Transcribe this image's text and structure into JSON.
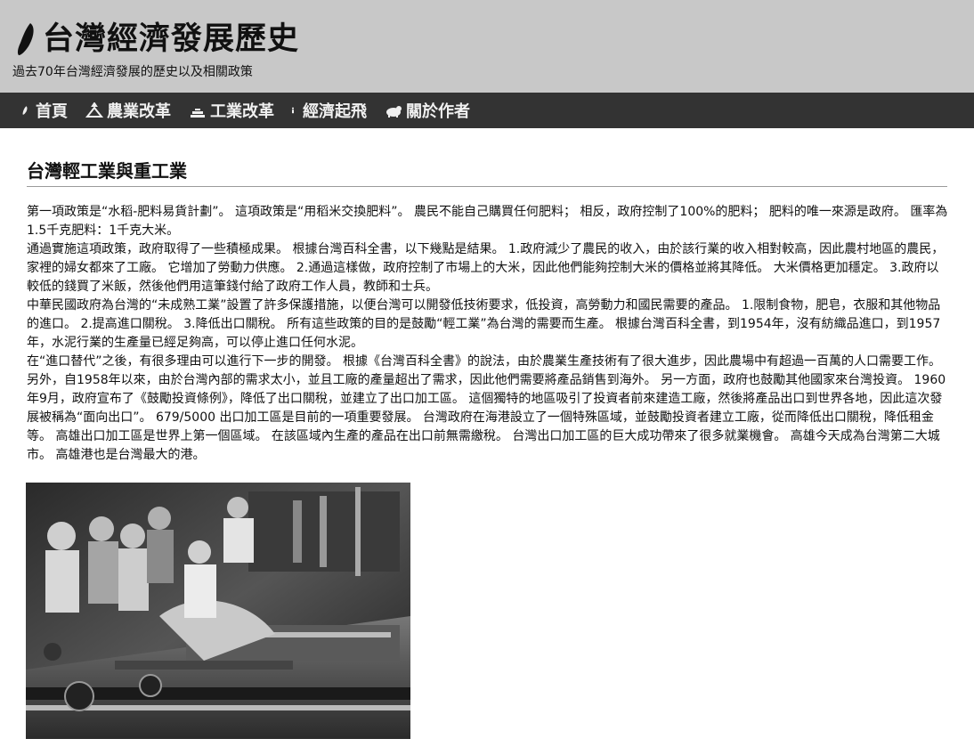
{
  "header": {
    "title": "台灣經濟發展歷史",
    "subtitle": "過去70年台灣經濟發展的歷史以及相關政策",
    "logo_icon": "taiwan-leaf-icon"
  },
  "nav": {
    "items": [
      {
        "label": "首頁",
        "icon": "leaf-icon"
      },
      {
        "label": "農業改革",
        "icon": "farmer-icon"
      },
      {
        "label": "工業改革",
        "icon": "factory-icon"
      },
      {
        "label": "經濟起飛",
        "icon": "info-icon"
      },
      {
        "label": "關於作者",
        "icon": "bear-icon"
      }
    ]
  },
  "article": {
    "heading": "台灣輕工業與重工業",
    "paragraphs": [
      "第一項政策是“水稻-肥料易貨計劃”。 這項政策是“用稻米交換肥料”。 農民不能自己購買任何肥料； 相反，政府控制了100%的肥料； 肥料的唯一來源是政府。 匯率為1.5千克肥料：1千克大米。",
      "通過實施這項政策，政府取得了一些積極成果。 根據台灣百科全書，以下幾點是結果。 1.政府減少了農民的收入，由於該行業的收入相對較高，因此農村地區的農民，家裡的婦女都來了工廠。 它增加了勞動力供應。 2.通過這樣做，政府控制了市場上的大米，因此他們能夠控制大米的價格並將其降低。 大米價格更加穩定。 3.政府以較低的錢買了米飯，然後他們用這筆錢付給了政府工作人員，教師和士兵。",
      "中華民國政府為台灣的“未成熟工業”設置了許多保護措施，以便台灣可以開發低技術要求，低投資，高勞動力和國民需要的產品。 1.限制食物，肥皂，衣服和其他物品的進口。 2.提高進口關稅。 3.降低出口關稅。 所有這些政策的目的是鼓勵“輕工業”為台灣的需要而生產。 根據台灣百科全書，到1954年，沒有紡織品進口，到1957年，水泥行業的生產量已經足夠高，可以停止進口任何水泥。",
      "在“進口替代”之後，有很多理由可以進行下一步的開發。 根據《台灣百科全書》的說法，由於農業生產技術有了很大進步，因此農場中有超過一百萬的人口需要工作。 另外，自1958年以來，由於台灣內部的需求太小，並且工廠的產量超出了需求，因此他們需要將產品銷售到海外。 另一方面，政府也鼓勵其他國家來台灣投資。 1960年9月，政府宣布了《鼓勵投資條例》，降低了出口關稅，並建立了出口加工區。 這個獨特的地區吸引了投資者前來建造工廠，然後將產品出口到世界各地，因此這次發展被稱為“面向出口”。 679/5000 出口加工區是目前的一項重要發展。 台灣政府在海港設立了一個特殊區域，並鼓勵投資者建立工廠，從而降低出口關稅，降低租金等。 高雄出口加工區是世界上第一個區域。 在該區域內生產的產品在出口前無需繳稅。 台灣出口加工區的巨大成功帶來了很多就業機會。 高雄今天成為台灣第二大城市。 高雄港也是台灣最大的港。"
    ]
  },
  "colors": {
    "header_bg": "#c8c8c8",
    "nav_bg": "#333333",
    "nav_text": "#f0f0f0"
  }
}
